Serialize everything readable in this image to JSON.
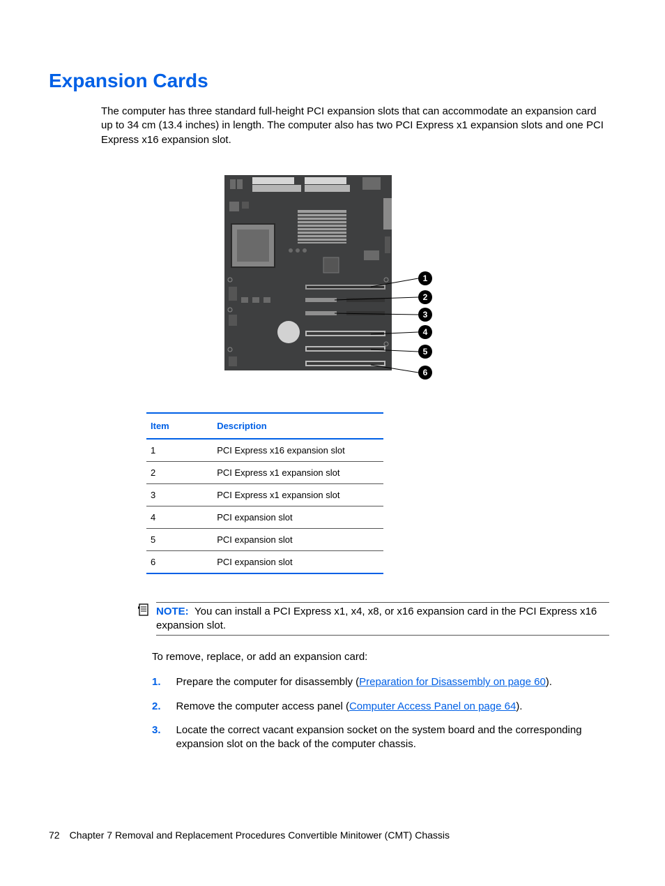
{
  "heading": "Expansion Cards",
  "intro": "The computer has three standard full-height PCI expansion slots that can accommodate an expansion card up to 34 cm (13.4 inches) in length. The computer also has two PCI Express x1 expansion slots and one PCI Express x16 expansion slot.",
  "callouts": [
    "1",
    "2",
    "3",
    "4",
    "5",
    "6"
  ],
  "table": {
    "headers": {
      "item": "Item",
      "desc": "Description"
    },
    "rows": [
      {
        "item": "1",
        "desc": "PCI Express x16 expansion slot"
      },
      {
        "item": "2",
        "desc": "PCI Express x1 expansion slot"
      },
      {
        "item": "3",
        "desc": "PCI Express x1 expansion slot"
      },
      {
        "item": "4",
        "desc": "PCI expansion slot"
      },
      {
        "item": "5",
        "desc": "PCI expansion slot"
      },
      {
        "item": "6",
        "desc": "PCI expansion slot"
      }
    ]
  },
  "note": {
    "label": "NOTE:",
    "text": "You can install a PCI Express x1, x4, x8, or x16 expansion card in the PCI Express x16 expansion slot."
  },
  "para_remove": "To remove, replace, or add an expansion card:",
  "steps": [
    {
      "num": "1.",
      "pre": "Prepare the computer for disassembly (",
      "link": "Preparation for Disassembly on page 60",
      "post": ")."
    },
    {
      "num": "2.",
      "pre": "Remove the computer access panel (",
      "link": "Computer Access Panel on page 64",
      "post": ")."
    },
    {
      "num": "3.",
      "pre": "Locate the correct vacant expansion socket on the system board and the corresponding expansion slot on the back of the computer chassis.",
      "link": "",
      "post": ""
    }
  ],
  "footer": {
    "page": "72",
    "chapter": "Chapter 7   Removal and Replacement Procedures Convertible Minitower (CMT) Chassis"
  }
}
